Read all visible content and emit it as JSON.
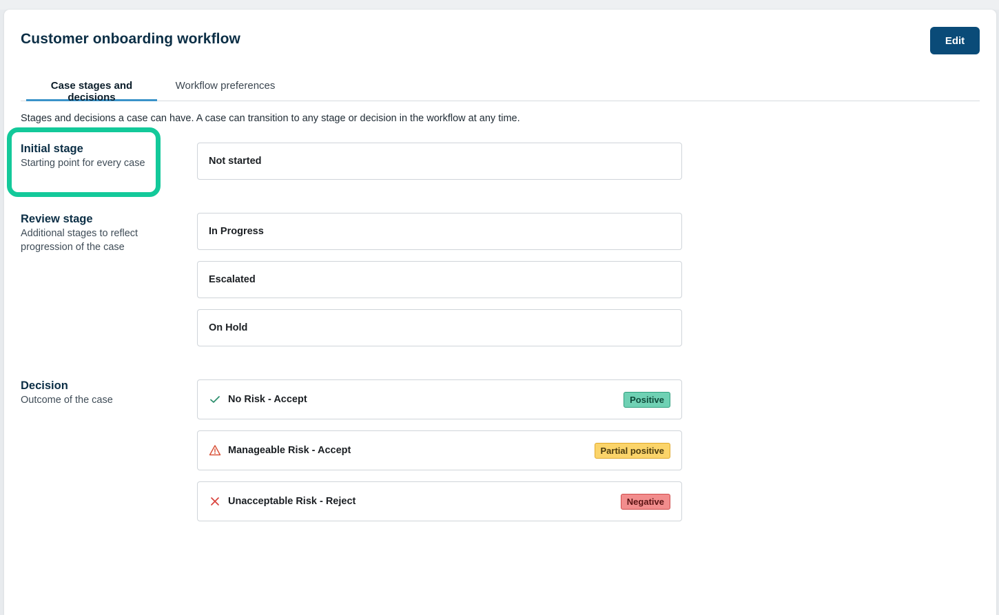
{
  "header": {
    "title": "Customer onboarding workflow",
    "edit_label": "Edit"
  },
  "tabs": [
    {
      "label": "Case stages and decisions",
      "active": true
    },
    {
      "label": "Workflow preferences",
      "active": false
    }
  ],
  "description": "Stages and decisions a case can have. A case can transition to any stage or decision in the workflow at any time.",
  "sections": {
    "initial": {
      "title": "Initial stage",
      "subtitle": "Starting point for every case",
      "items": [
        "Not started"
      ]
    },
    "review": {
      "title": "Review stage",
      "subtitle": "Additional stages to reflect progression of the case",
      "items": [
        "In Progress",
        "Escalated",
        "On Hold"
      ]
    },
    "decision": {
      "title": "Decision",
      "subtitle": "Outcome of the case",
      "items": [
        {
          "label": "No Risk - Accept",
          "icon": "check-icon",
          "badge": "Positive",
          "badge_color": "#6fd1b4"
        },
        {
          "label": "Manageable Risk - Accept",
          "icon": "warning-triangle-icon",
          "badge": "Partial positive",
          "badge_color": "#fbd46a"
        },
        {
          "label": "Unacceptable Risk - Reject",
          "icon": "x-icon",
          "badge": "Negative",
          "badge_color": "#f28d8d"
        }
      ]
    }
  },
  "colors": {
    "primary": "#0a4b78",
    "highlight": "#13c99a",
    "tab_underline": "#3a93c9"
  }
}
